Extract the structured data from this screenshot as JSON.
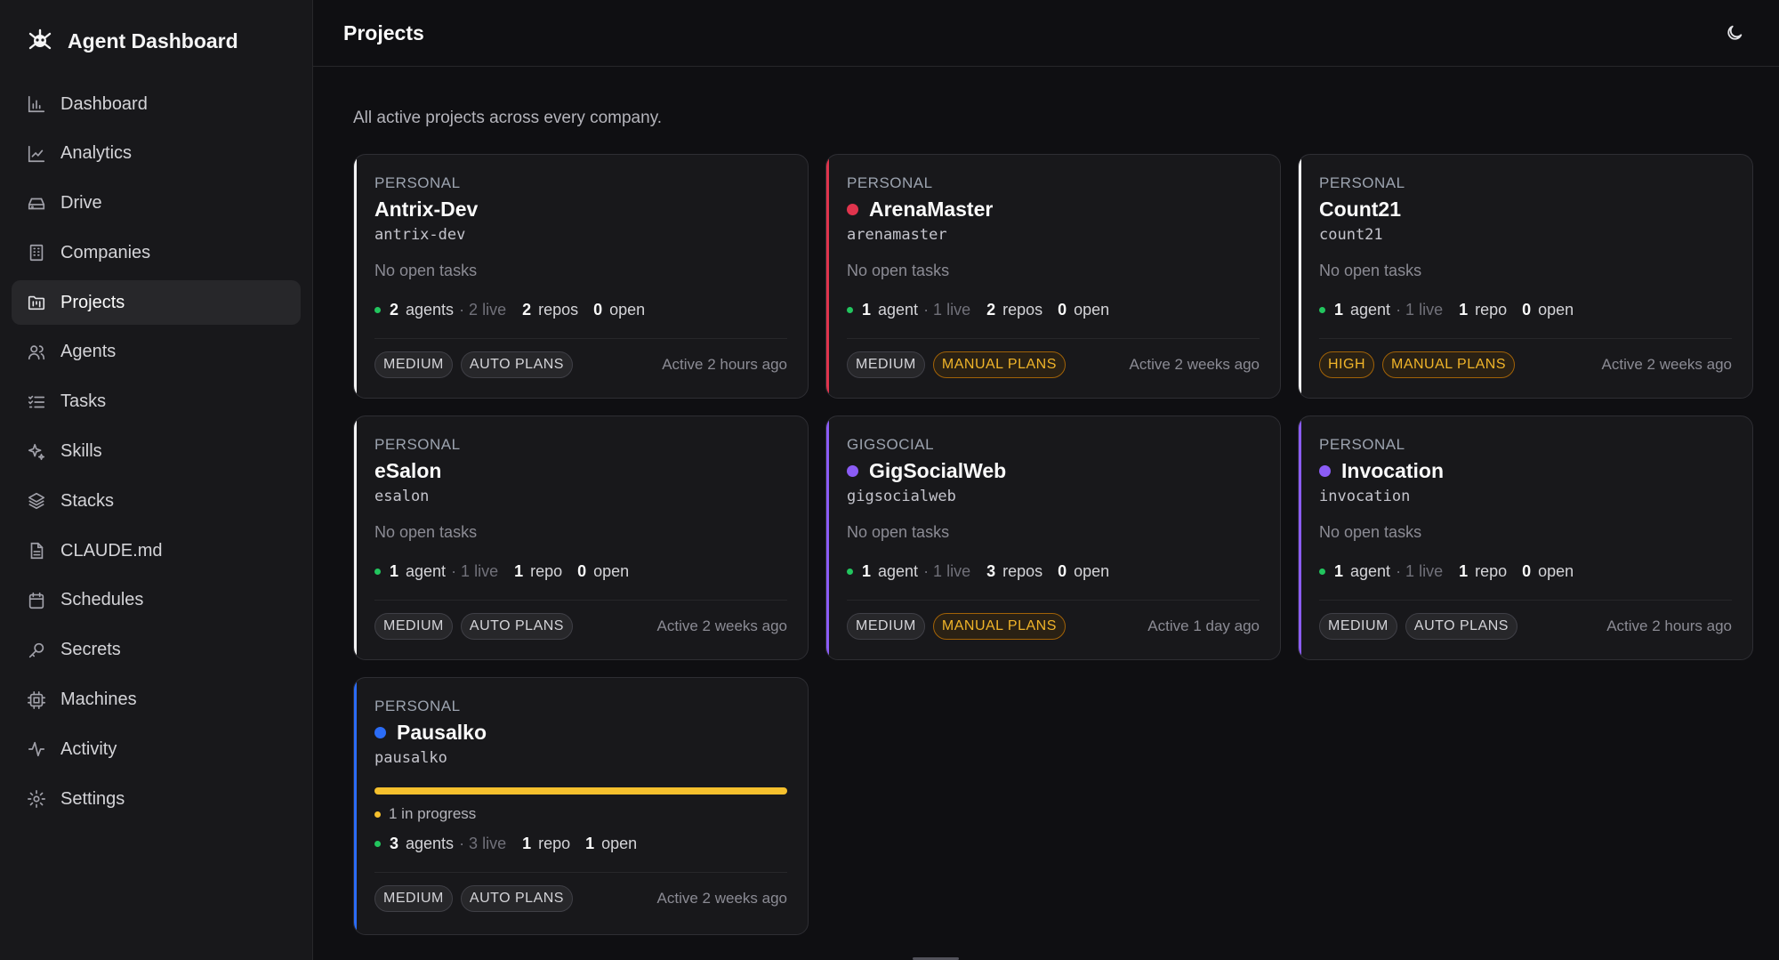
{
  "app": {
    "title": "Agent Dashboard"
  },
  "sidebar": {
    "items": [
      {
        "label": "Dashboard",
        "icon": "bar-chart-icon"
      },
      {
        "label": "Analytics",
        "icon": "line-chart-icon"
      },
      {
        "label": "Drive",
        "icon": "hard-drive-icon"
      },
      {
        "label": "Companies",
        "icon": "building-icon"
      },
      {
        "label": "Projects",
        "icon": "folder-kanban-icon",
        "active": true
      },
      {
        "label": "Agents",
        "icon": "users-icon"
      },
      {
        "label": "Tasks",
        "icon": "list-checks-icon"
      },
      {
        "label": "Skills",
        "icon": "sparkles-icon"
      },
      {
        "label": "Stacks",
        "icon": "layers-icon"
      },
      {
        "label": "CLAUDE.md",
        "icon": "file-text-icon"
      },
      {
        "label": "Schedules",
        "icon": "calendar-icon"
      },
      {
        "label": "Secrets",
        "icon": "key-icon"
      },
      {
        "label": "Machines",
        "icon": "cpu-icon"
      },
      {
        "label": "Activity",
        "icon": "activity-icon"
      },
      {
        "label": "Settings",
        "icon": "gear-icon"
      }
    ]
  },
  "header": {
    "title": "Projects",
    "theme_icon": "moon-icon"
  },
  "main": {
    "subtitle": "All active projects across every company."
  },
  "colors": {
    "green": "#22c55e",
    "amber": "#f5c02d",
    "red": "#e0344d",
    "purple": "#8b5cf6",
    "blue": "#2b6cf6",
    "white": "#f4f4f5"
  },
  "projects": [
    {
      "company": "PERSONAL",
      "name": "Antrix-Dev",
      "slug": "antrix-dev",
      "tasks": "No open tasks",
      "agents_n": "2",
      "agents_word": "agents",
      "live": "· 2 live",
      "repos_n": "2",
      "repos_word": "repos",
      "open_n": "0",
      "open_word": "open",
      "priority": "MEDIUM",
      "plans": "AUTO PLANS",
      "active": "Active 2 hours ago"
    },
    {
      "company": "PERSONAL",
      "name": "ArenaMaster",
      "slug": "arenamaster",
      "tasks": "No open tasks",
      "agents_n": "1",
      "agents_word": "agent",
      "live": "· 1 live",
      "repos_n": "2",
      "repos_word": "repos",
      "open_n": "0",
      "open_word": "open",
      "priority": "MEDIUM",
      "plans": "MANUAL PLANS",
      "active": "Active 2 weeks ago"
    },
    {
      "company": "PERSONAL",
      "name": "Count21",
      "slug": "count21",
      "tasks": "No open tasks",
      "agents_n": "1",
      "agents_word": "agent",
      "live": "· 1 live",
      "repos_n": "1",
      "repos_word": "repo",
      "open_n": "0",
      "open_word": "open",
      "priority": "HIGH",
      "plans": "MANUAL PLANS",
      "active": "Active 2 weeks ago"
    },
    {
      "company": "PERSONAL",
      "name": "eSalon",
      "slug": "esalon",
      "tasks": "No open tasks",
      "agents_n": "1",
      "agents_word": "agent",
      "live": "· 1 live",
      "repos_n": "1",
      "repos_word": "repo",
      "open_n": "0",
      "open_word": "open",
      "priority": "MEDIUM",
      "plans": "AUTO PLANS",
      "active": "Active 2 weeks ago"
    },
    {
      "company": "GIGSOCIAL",
      "name": "GigSocialWeb",
      "slug": "gigsocialweb",
      "tasks": "No open tasks",
      "agents_n": "1",
      "agents_word": "agent",
      "live": "· 1 live",
      "repos_n": "3",
      "repos_word": "repos",
      "open_n": "0",
      "open_word": "open",
      "priority": "MEDIUM",
      "plans": "MANUAL PLANS",
      "active": "Active 1 day ago"
    },
    {
      "company": "PERSONAL",
      "name": "Invocation",
      "slug": "invocation",
      "tasks": "No open tasks",
      "agents_n": "1",
      "agents_word": "agent",
      "live": "· 1 live",
      "repos_n": "1",
      "repos_word": "repo",
      "open_n": "0",
      "open_word": "open",
      "priority": "MEDIUM",
      "plans": "AUTO PLANS",
      "active": "Active 2 hours ago"
    },
    {
      "company": "PERSONAL",
      "name": "Pausalko",
      "slug": "pausalko",
      "progress_fraction": 1.0,
      "in_progress": "1 in progress",
      "agents_n": "3",
      "agents_word": "agents",
      "live": "· 3 live",
      "repos_n": "1",
      "repos_word": "repo",
      "open_n": "1",
      "open_word": "open",
      "priority": "MEDIUM",
      "plans": "AUTO PLANS",
      "active": "Active 2 weeks ago"
    }
  ]
}
